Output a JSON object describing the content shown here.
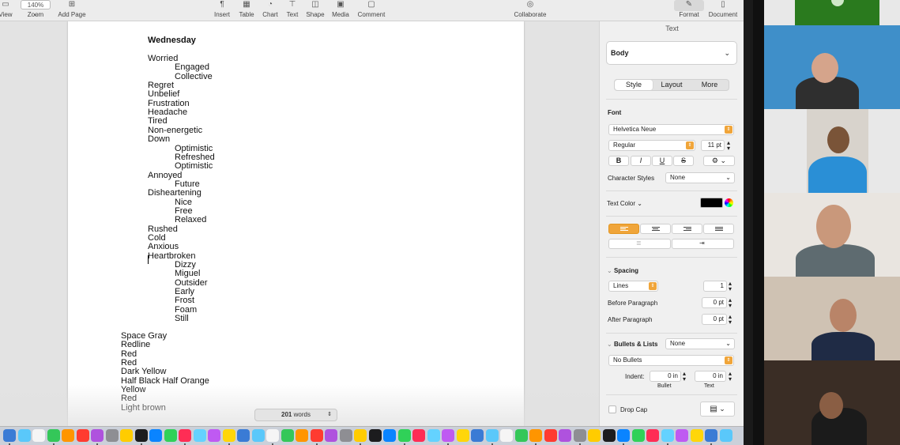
{
  "toolbar": {
    "view": "View",
    "zoom_value": "140%",
    "zoom": "Zoom",
    "add_page": "Add Page",
    "insert": "Insert",
    "table": "Table",
    "chart": "Chart",
    "text": "Text",
    "shape": "Shape",
    "media": "Media",
    "comment": "Comment",
    "collaborate": "Collaborate",
    "format": "Format",
    "document": "Document"
  },
  "document": {
    "heading": "Wednesday",
    "lines": [
      {
        "text": "Worried",
        "indent": 0
      },
      {
        "text": "Engaged",
        "indent": 1
      },
      {
        "text": "Collective",
        "indent": 1
      },
      {
        "text": "Regret",
        "indent": 0
      },
      {
        "text": "Unbelief",
        "indent": 0
      },
      {
        "text": "Frustration",
        "indent": 0
      },
      {
        "text": "Headache",
        "indent": 0
      },
      {
        "text": "Tired",
        "indent": 0
      },
      {
        "text": "Non-energetic",
        "indent": 0
      },
      {
        "text": "Down",
        "indent": 0
      },
      {
        "text": "Optimistic",
        "indent": 1
      },
      {
        "text": "Refreshed",
        "indent": 1
      },
      {
        "text": "Optimistic",
        "indent": 1
      },
      {
        "text": "Annoyed",
        "indent": 0
      },
      {
        "text": "Future",
        "indent": 1
      },
      {
        "text": "Disheartening",
        "indent": 0
      },
      {
        "text": "Nice",
        "indent": 1
      },
      {
        "text": "Free",
        "indent": 1
      },
      {
        "text": "Relaxed",
        "indent": 1
      },
      {
        "text": "Rushed",
        "indent": 0
      },
      {
        "text": "Cold",
        "indent": 0
      },
      {
        "text": "Anxious",
        "indent": 0
      },
      {
        "text": "Heartbroken",
        "indent": 0
      },
      {
        "text": "Dizzy",
        "indent": 1
      },
      {
        "text": "Miguel",
        "indent": 1
      },
      {
        "text": "Outsider",
        "indent": 1
      },
      {
        "text": "Early",
        "indent": 1
      },
      {
        "text": "Frost",
        "indent": 1
      },
      {
        "text": "Foam",
        "indent": 1
      },
      {
        "text": "Still",
        "indent": 1
      }
    ],
    "colors": [
      "Space Gray",
      "Redline",
      "Red",
      "Red",
      "Dark Yellow",
      "Half Black Half Orange",
      "Yellow",
      "Red",
      "Light brown"
    ]
  },
  "status": {
    "word_count": "201",
    "words_label": "words"
  },
  "sidebar": {
    "section_title": "Text",
    "paragraph_style": "Body",
    "tabs": [
      "Style",
      "Layout",
      "More"
    ],
    "active_tab": "Style",
    "font_label": "Font",
    "font_family": "Helvetica Neue",
    "font_typeface": "Regular",
    "font_size": "11 pt",
    "bold": "B",
    "italic": "I",
    "underline": "U",
    "strike": "S",
    "character_styles_label": "Character Styles",
    "character_styles_value": "None",
    "text_color_label": "Text Color",
    "text_color_value": "#000000",
    "spacing_label": "Spacing",
    "spacing_mode": "Lines",
    "spacing_value": "1",
    "before_paragraph_label": "Before Paragraph",
    "before_paragraph_value": "0 pt",
    "after_paragraph_label": "After Paragraph",
    "after_paragraph_value": "0 pt",
    "bullets_label": "Bullets & Lists",
    "bullets_value": "None",
    "bullet_style": "No Bullets",
    "indent_label": "Indent:",
    "indent_bullet_value": "0 in",
    "indent_text_value": "0 in",
    "bullet_caption": "Bullet",
    "text_caption": "Text",
    "drop_cap_label": "Drop Cap"
  },
  "colors": {
    "accent": "#f0a53a",
    "toolbar_bg": "#ececec",
    "sidebar_bg": "#f0f0f0"
  }
}
